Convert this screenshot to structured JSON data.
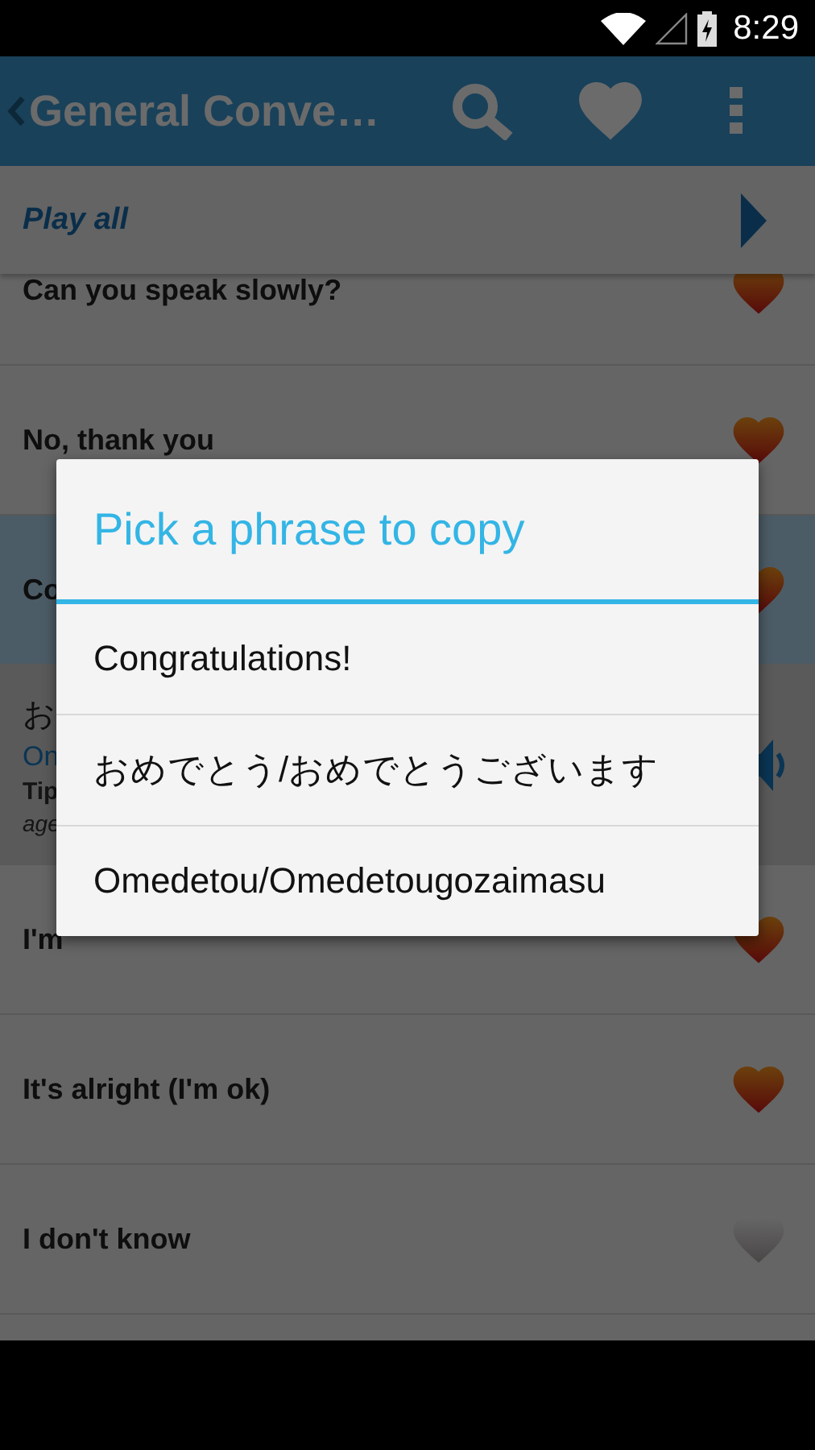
{
  "status_bar": {
    "time": "8:29"
  },
  "app_bar": {
    "title": "General Conve…"
  },
  "play_all": {
    "label": "Play all"
  },
  "phrases": [
    {
      "kind": "phrase",
      "text": "Can you speak slowly?",
      "favorite": true,
      "selected": false
    },
    {
      "kind": "phrase",
      "text": "No, thank you",
      "favorite": true,
      "selected": false
    },
    {
      "kind": "phrase",
      "text": "Co",
      "favorite": true,
      "selected": true
    },
    {
      "kind": "expanded",
      "japanese": "お",
      "romaji": "On",
      "tip": "Tip",
      "note": "age",
      "selected": false
    },
    {
      "kind": "phrase",
      "text": "I'm",
      "favorite": true,
      "selected": false
    },
    {
      "kind": "phrase",
      "text": "It's alright (I'm ok)",
      "favorite": true,
      "selected": false
    },
    {
      "kind": "phrase",
      "text": "I don't know",
      "favorite": false,
      "selected": false
    }
  ],
  "dialog": {
    "title": "Pick a phrase to copy",
    "options": [
      "Congratulations!",
      "おめでとう/おめでとうございます",
      "Omedetou/Omedetougozaimasu"
    ]
  }
}
